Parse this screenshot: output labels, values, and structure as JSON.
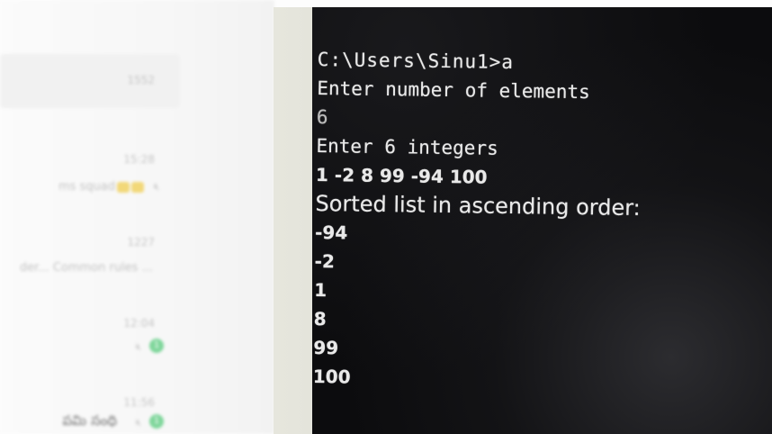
{
  "chat_list": {
    "rows": [
      {
        "time": "1552",
        "snippet": "",
        "highlight": true
      },
      {
        "time": "15:28",
        "snippet": "ms squad",
        "emoji": true,
        "mute": true
      },
      {
        "time": "1227",
        "snippet": "der... Common rules ..."
      },
      {
        "time": "12:04",
        "snippet": "",
        "mute": true,
        "badge": "1"
      },
      {
        "time": "11:56",
        "snippet": "పమి సంధి",
        "mute": true,
        "badge": "1",
        "dark": true
      }
    ]
  },
  "terminal": {
    "lines": [
      "C:\\Users\\Sinu1>a",
      "Enter number of elements",
      "6",
      "Enter 6 integers",
      "1 -2 8 99 -94 100",
      "Sorted list in ascending order:",
      "-94",
      "-2",
      "1",
      "8",
      "99",
      "100"
    ]
  }
}
